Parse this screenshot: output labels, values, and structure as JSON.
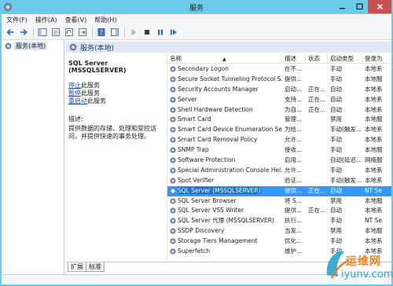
{
  "window": {
    "title": "服务"
  },
  "menu": [
    "文件(F)",
    "操作(A)",
    "查看(V)",
    "帮助(H)"
  ],
  "tree": {
    "item_label": "服务(本地)"
  },
  "pane": {
    "header": "服务(本地)",
    "selected_service": "SQL Server (MSSQLSERVER)",
    "actions": [
      {
        "link": "停止",
        "suffix": "此服务"
      },
      {
        "link": "暂停",
        "suffix": "此服务"
      },
      {
        "link": "重启动",
        "suffix": "此服务"
      }
    ],
    "description_label": "描述:",
    "description_text": "提供数据的存储、处理和受控访问，并提供快速的事务处理。"
  },
  "columns": {
    "name": "名称",
    "desc": "描述",
    "status": "状态",
    "start": "启动类型",
    "logon": "登录为"
  },
  "services": [
    {
      "name": "Secondary Logon",
      "desc": "在不...",
      "status": "",
      "start": "手动",
      "logon": "本地系"
    },
    {
      "name": "Secure Socket Tunneling Protocol S...",
      "desc": "提供...",
      "status": "",
      "start": "手动",
      "logon": "本地服"
    },
    {
      "name": "Security Accounts Manager",
      "desc": "启动...",
      "status": "正在...",
      "start": "自动",
      "logon": "本地系"
    },
    {
      "name": "Server",
      "desc": "支持...",
      "status": "正在...",
      "start": "自动",
      "logon": "本地系"
    },
    {
      "name": "Shell Hardware Detection",
      "desc": "为自...",
      "status": "正在...",
      "start": "自动",
      "logon": "本地系"
    },
    {
      "name": "Smart Card",
      "desc": "管理...",
      "status": "",
      "start": "禁用",
      "logon": "本地服"
    },
    {
      "name": "Smart Card Device Enumeration Se...",
      "desc": "为给...",
      "status": "",
      "start": "手动(触发...",
      "logon": "本地系"
    },
    {
      "name": "Smart Card Removal Policy",
      "desc": "允许...",
      "status": "",
      "start": "手动",
      "logon": "本地系"
    },
    {
      "name": "SNMP Trap",
      "desc": "接收...",
      "status": "",
      "start": "手动",
      "logon": "本地服"
    },
    {
      "name": "Software Protection",
      "desc": "启用...",
      "status": "",
      "start": "自动(延迟...",
      "logon": "网络服"
    },
    {
      "name": "Special Administration Console Hel...",
      "desc": "允许...",
      "status": "",
      "start": "手动",
      "logon": "本地系"
    },
    {
      "name": "Spot Verifier",
      "desc": "验证...",
      "status": "",
      "start": "手动(触发...",
      "logon": "本地系"
    },
    {
      "name": "SQL Server (MSSQLSERVER)",
      "desc": "提供...",
      "status": "正在...",
      "start": "自动",
      "logon": "NT Se",
      "selected": true
    },
    {
      "name": "SQL Server Browser",
      "desc": "将 S...",
      "status": "",
      "start": "禁用",
      "logon": "本地服"
    },
    {
      "name": "SQL Server VSS Writer",
      "desc": "提供...",
      "status": "正在...",
      "start": "自动",
      "logon": "本地系"
    },
    {
      "name": "SQL Server 代理 (MSSQLSERVER)",
      "desc": "执行...",
      "status": "",
      "start": "手动",
      "logon": "NT Se"
    },
    {
      "name": "SSDP Discovery",
      "desc": "当发...",
      "status": "",
      "start": "禁用",
      "logon": "本地服"
    },
    {
      "name": "Storage Tiers Management",
      "desc": "优化...",
      "status": "",
      "start": "手动",
      "logon": "本地系"
    },
    {
      "name": "Superfetch",
      "desc": "维护...",
      "status": "",
      "start": "手动",
      "logon": "本地系"
    }
  ],
  "tabs": [
    "扩展",
    "标准"
  ],
  "watermark": {
    "line1": "运维网",
    "line2": "iyunv.com"
  },
  "colors": {
    "title_bar": "#6dcbe9",
    "selection": "#3399ff",
    "close_button": "#c75050",
    "link": "#1f4fb0"
  }
}
